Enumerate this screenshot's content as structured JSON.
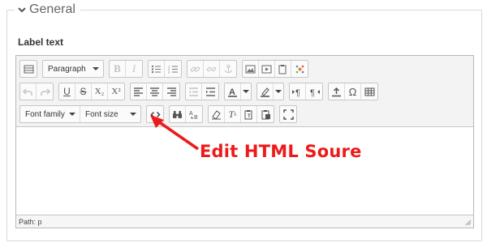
{
  "fieldset": {
    "legend": "General"
  },
  "form": {
    "label_text": "Label text"
  },
  "toolbar": {
    "row1": {
      "paragraph_select": "Paragraph",
      "bold": "B",
      "italic": "I"
    },
    "row2": {
      "subscript": "X₂",
      "superscript": "X²"
    },
    "row3": {
      "font_family": "Font family",
      "font_size": "Font size"
    }
  },
  "status": {
    "path": "Path: p"
  },
  "annotation": {
    "text": "Edit HTML Soure",
    "color": "#ee1a1a"
  },
  "colors": {
    "border": "#d8d8d8",
    "toolbar_bg": "#f3f3f3",
    "accent": "#ee1a1a"
  }
}
